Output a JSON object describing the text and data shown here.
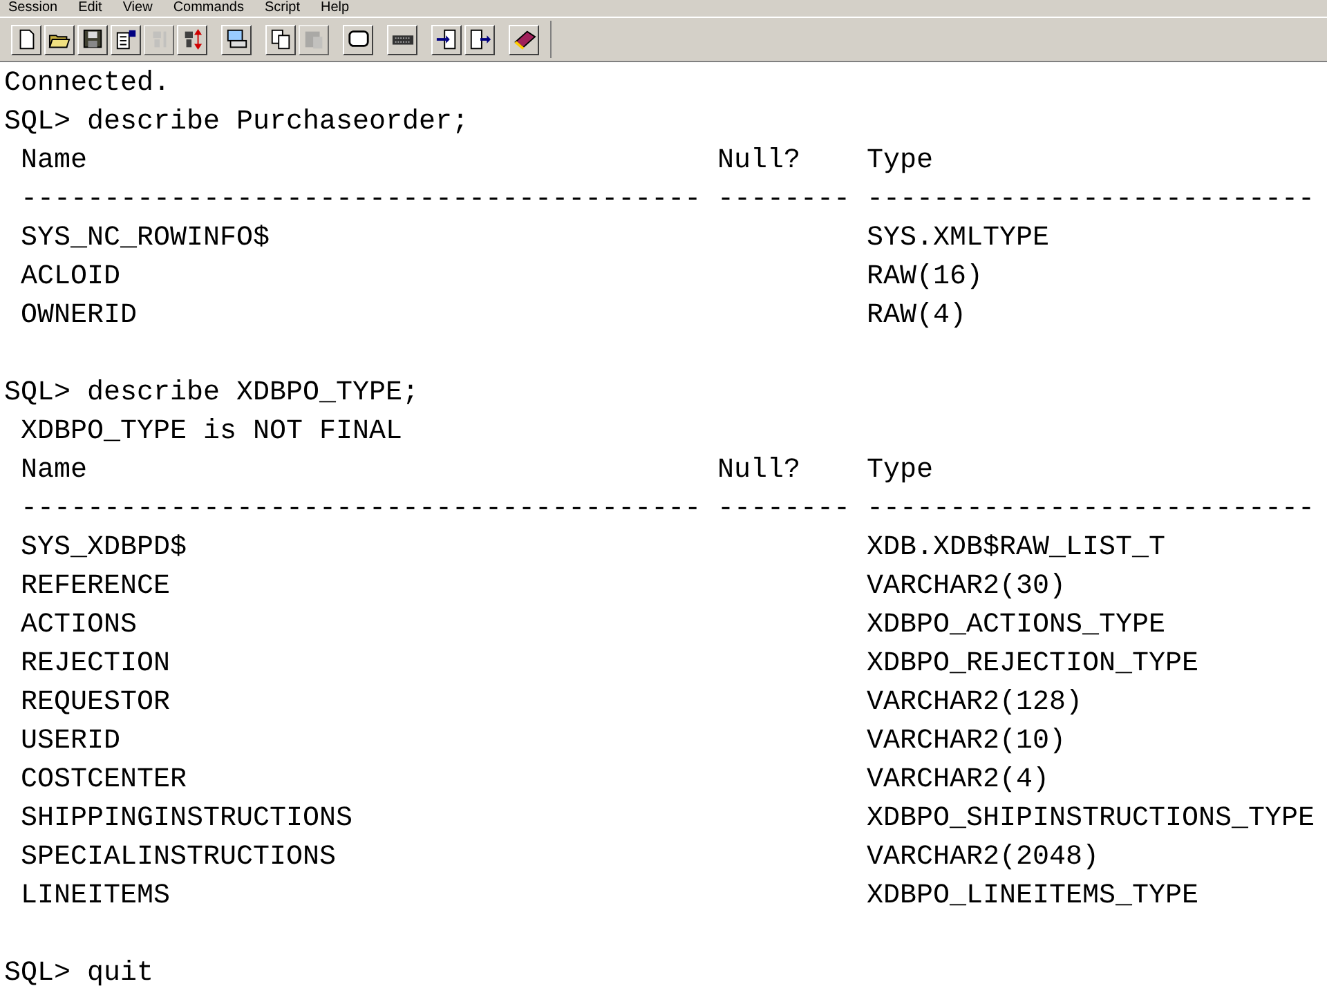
{
  "menu": [
    "Session",
    "Edit",
    "View",
    "Commands",
    "Script",
    "Help"
  ],
  "toolbar": [
    {
      "disabled": false
    },
    {
      "disabled": false
    },
    {
      "disabled": false
    },
    {
      "disabled": false
    },
    {
      "disabled": true
    },
    {
      "disabled": false
    },
    {
      "disabled": false
    },
    {
      "disabled": false
    },
    {
      "disabled": true
    },
    {
      "disabled": false
    },
    {
      "disabled": false
    },
    {
      "disabled": false
    },
    {
      "disabled": false
    },
    {
      "disabled": false
    }
  ],
  "console": [
    {
      "kind": "text",
      "text": "Connected."
    },
    {
      "kind": "text",
      "text": "SQL> describe Purchaseorder;"
    },
    {
      "kind": "table",
      "columns": [
        "Name",
        "Null?",
        "Type"
      ],
      "rules": [
        "-----------------------------------------",
        "--------",
        "---------------------------"
      ],
      "rows": [
        {
          "name": "SYS_NC_ROWINFO$",
          "type": "SYS.XMLTYPE"
        },
        {
          "name": "ACLOID",
          "type": "RAW(16)"
        },
        {
          "name": "OWNERID",
          "type": "RAW(4)"
        }
      ]
    },
    {
      "kind": "gap"
    },
    {
      "kind": "text",
      "text": "SQL> describe XDBPO_TYPE;"
    },
    {
      "kind": "text",
      "text": " XDBPO_TYPE is NOT FINAL"
    },
    {
      "kind": "table",
      "columns": [
        "Name",
        "Null?",
        "Type"
      ],
      "rules": [
        "-----------------------------------------",
        "--------",
        "---------------------------"
      ],
      "rows": [
        {
          "name": "SYS_XDBPD$",
          "type": "XDB.XDB$RAW_LIST_T"
        },
        {
          "name": "REFERENCE",
          "type": "VARCHAR2(30)"
        },
        {
          "name": "ACTIONS",
          "type": "XDBPO_ACTIONS_TYPE"
        },
        {
          "name": "REJECTION",
          "type": "XDBPO_REJECTION_TYPE"
        },
        {
          "name": "REQUESTOR",
          "type": "VARCHAR2(128)"
        },
        {
          "name": "USERID",
          "type": "VARCHAR2(10)"
        },
        {
          "name": "COSTCENTER",
          "type": "VARCHAR2(4)"
        },
        {
          "name": "SHIPPINGINSTRUCTIONS",
          "type": "XDBPO_SHIPINSTRUCTIONS_TYPE"
        },
        {
          "name": "SPECIALINSTRUCTIONS",
          "type": "VARCHAR2(2048)"
        },
        {
          "name": "LINEITEMS",
          "type": "XDBPO_LINEITEMS_TYPE"
        }
      ]
    },
    {
      "kind": "gap"
    },
    {
      "kind": "text",
      "text": "SQL> quit"
    }
  ]
}
